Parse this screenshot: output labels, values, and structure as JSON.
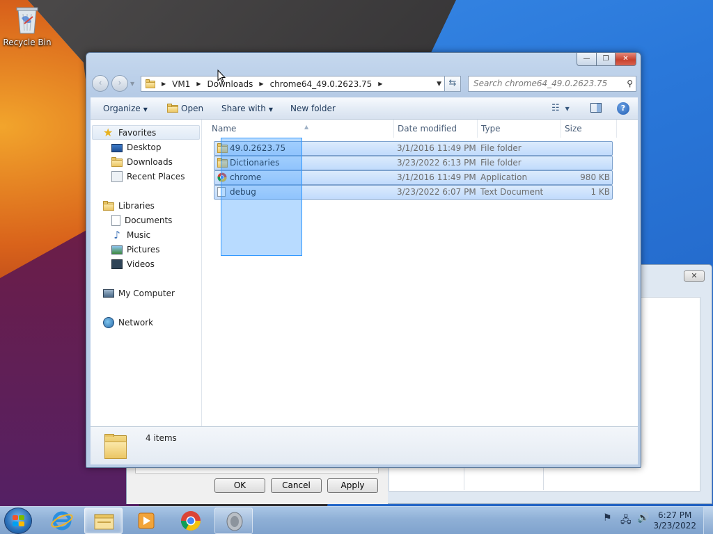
{
  "desktop": {
    "recycle_bin_label": "Recycle Bin"
  },
  "background_dialog": {
    "close_label": "✕",
    "ok_label": "OK",
    "cancel_label": "Cancel",
    "apply_label": "Apply"
  },
  "explorer": {
    "caption": {
      "minimize": "—",
      "maximize": "❐",
      "close": "✕"
    },
    "nav": {
      "back_icon": "‹",
      "forward_icon": "›",
      "breadcrumb": [
        "VM1",
        "Downloads",
        "chrome64_49.0.2623.75"
      ],
      "search_placeholder": "Search chrome64_49.0.2623.75",
      "search_icon": "⚲"
    },
    "toolbar": {
      "organize": "Organize",
      "open": "Open",
      "share_with": "Share with",
      "new_folder": "New folder",
      "help": "?"
    },
    "sidebar": {
      "favorites": "Favorites",
      "favorites_items": [
        "Desktop",
        "Downloads",
        "Recent Places"
      ],
      "libraries": "Libraries",
      "libraries_items": [
        "Documents",
        "Music",
        "Pictures",
        "Videos"
      ],
      "computer": "My Computer",
      "network": "Network"
    },
    "columns": [
      "Name",
      "Date modified",
      "Type",
      "Size"
    ],
    "files": [
      {
        "name": "49.0.2623.75",
        "date": "3/1/2016 11:49 PM",
        "type": "File folder",
        "size": "",
        "icon": "folder-icon"
      },
      {
        "name": "Dictionaries",
        "date": "3/23/2022 6:13 PM",
        "type": "File folder",
        "size": "",
        "icon": "folder-icon"
      },
      {
        "name": "chrome",
        "date": "3/1/2016 11:49 PM",
        "type": "Application",
        "size": "980 KB",
        "icon": "chrome-icon"
      },
      {
        "name": "debug",
        "date": "3/23/2022 6:07 PM",
        "type": "Text Document",
        "size": "1 KB",
        "icon": "text-document-icon"
      }
    ],
    "status": {
      "item_count": "4 items"
    }
  },
  "taskbar": {
    "time": "6:27 PM",
    "date": "3/23/2022"
  }
}
